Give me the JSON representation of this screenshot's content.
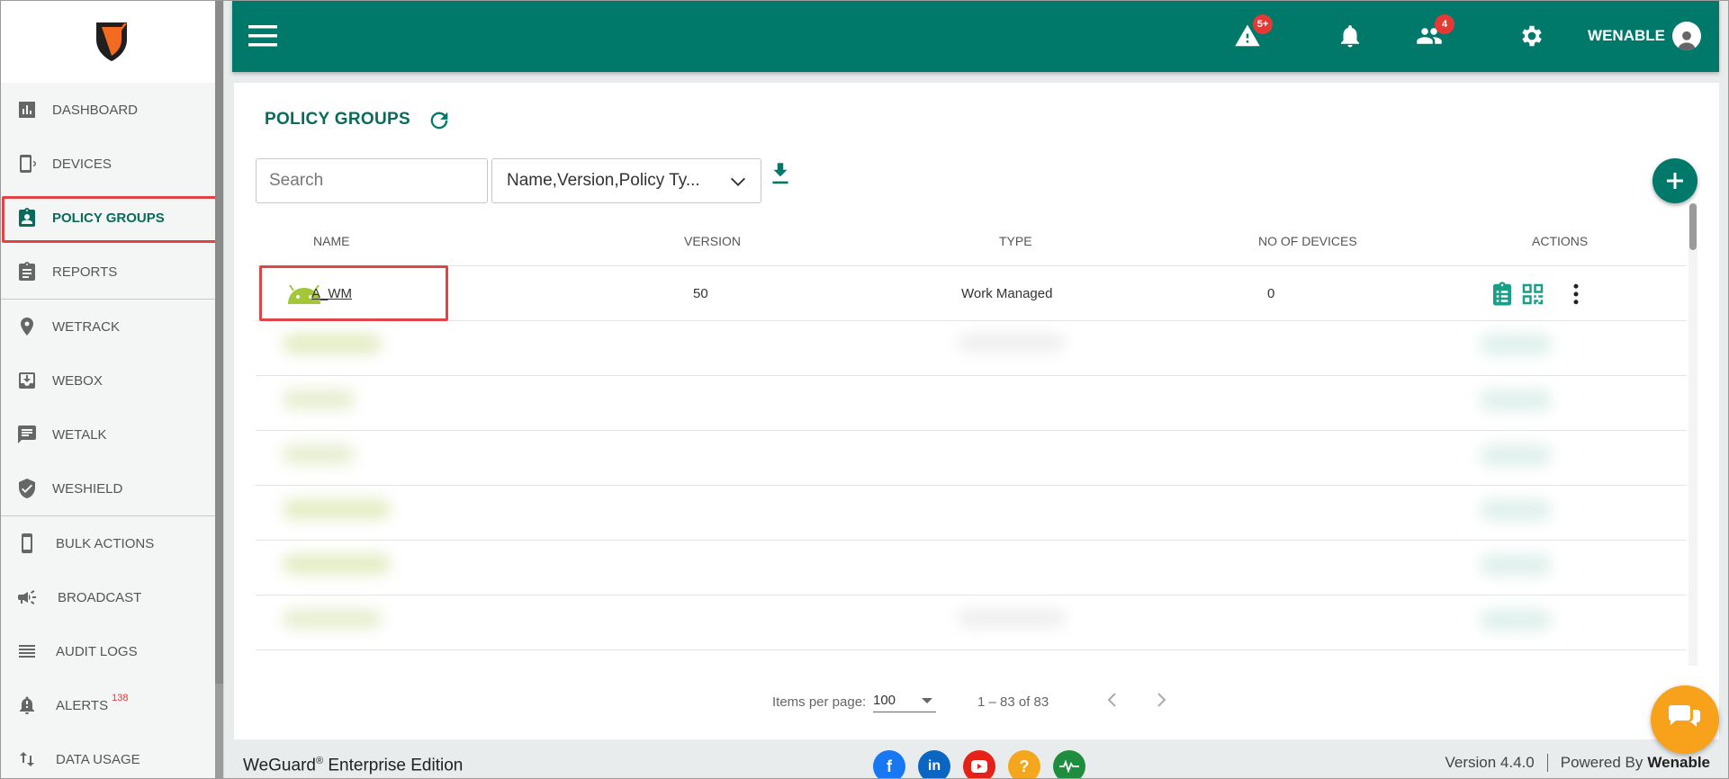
{
  "sidebar": {
    "items": [
      {
        "id": "dashboard",
        "label": "DASHBOARD",
        "icon": "bar-chart-icon"
      },
      {
        "id": "devices",
        "label": "DEVICES",
        "icon": "device-icon"
      },
      {
        "id": "policy-groups",
        "label": "POLICY GROUPS",
        "icon": "clipboard-user-icon",
        "active": true
      },
      {
        "id": "reports",
        "label": "REPORTS",
        "icon": "clipboard-icon"
      },
      {
        "id": "wetrack",
        "label": "WETRACK",
        "icon": "location-pin-icon"
      },
      {
        "id": "webox",
        "label": "WEBOX",
        "icon": "download-box-icon"
      },
      {
        "id": "wetalk",
        "label": "WETALK",
        "icon": "chat-icon"
      },
      {
        "id": "weshield",
        "label": "WESHIELD",
        "icon": "shield-check-icon"
      },
      {
        "id": "bulk-actions",
        "label": "BULK ACTIONS",
        "icon": "phone-icon"
      },
      {
        "id": "broadcast",
        "label": "BROADCAST",
        "icon": "megaphone-icon"
      },
      {
        "id": "audit-logs",
        "label": "AUDIT LOGS",
        "icon": "list-icon"
      },
      {
        "id": "alerts",
        "label": "ALERTS",
        "icon": "alert-bell-icon",
        "badge": "138"
      },
      {
        "id": "data-usage",
        "label": "DATA USAGE",
        "icon": "swap-vertical-icon"
      }
    ]
  },
  "header": {
    "alerts_badge": "5+",
    "users_badge": "4",
    "user_name": "WENABLE"
  },
  "page": {
    "title": "POLICY GROUPS",
    "search_placeholder": "Search",
    "filter_value": "Name,Version,Policy Ty..."
  },
  "table": {
    "columns": [
      "NAME",
      "VERSION",
      "TYPE",
      "NO OF DEVICES",
      "ACTIONS"
    ],
    "rows": [
      {
        "name": "A_WM",
        "version": "50",
        "type": "Work Managed",
        "devices": "0"
      }
    ]
  },
  "paginator": {
    "items_per_page_label": "Items per page:",
    "items_per_page": "100",
    "range": "1 – 83 of 83"
  },
  "footer": {
    "brand": "WeGuard",
    "reg": "®",
    "edition": " Enterprise Edition",
    "version": "Version 4.4.0",
    "powered_by": "Powered By",
    "company": "Wenable"
  },
  "colors": {
    "primary": "#00796b",
    "accent_text": "#086b5b",
    "badge": "#e53935",
    "highlight": "#e04444",
    "chat": "#f7a21a"
  }
}
